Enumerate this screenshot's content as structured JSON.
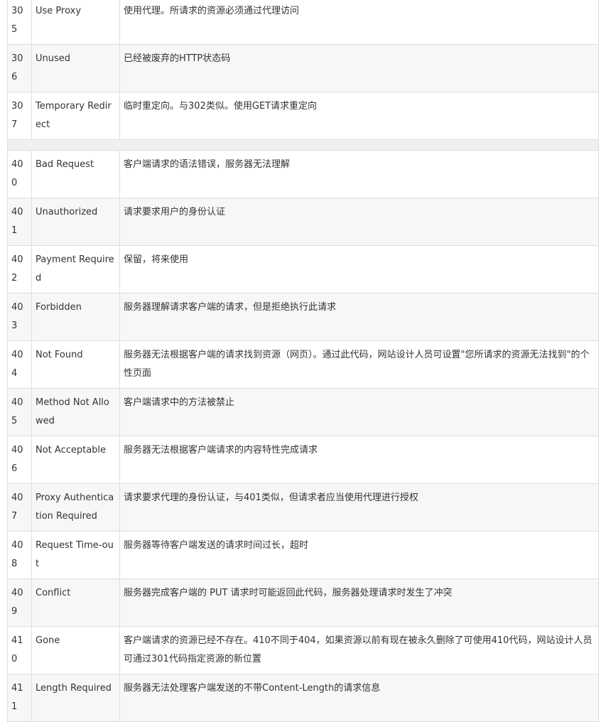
{
  "status_rows_3xx": [
    {
      "code": "305",
      "message": "Use Proxy",
      "description": "使用代理。所请求的资源必须通过代理访问"
    },
    {
      "code": "306",
      "message": "Unused",
      "description": "已经被废弃的HTTP状态码"
    },
    {
      "code": "307",
      "message": "Temporary Redirect",
      "description": "临时重定向。与302类似。使用GET请求重定向"
    }
  ],
  "status_rows_4xx": [
    {
      "code": "400",
      "message": "Bad Request",
      "description": "客户端请求的语法错误，服务器无法理解"
    },
    {
      "code": "401",
      "message": "Unauthorized",
      "description": "请求要求用户的身份认证"
    },
    {
      "code": "402",
      "message": "Payment Required",
      "description": "保留，将来使用"
    },
    {
      "code": "403",
      "message": "Forbidden",
      "description": "服务器理解请求客户端的请求，但是拒绝执行此请求"
    },
    {
      "code": "404",
      "message": "Not Found",
      "description": "服务器无法根据客户端的请求找到资源（网页）。通过此代码，网站设计人员可设置\"您所请求的资源无法找到\"的个性页面"
    },
    {
      "code": "405",
      "message": "Method Not Allowed",
      "description": "客户端请求中的方法被禁止"
    },
    {
      "code": "406",
      "message": "Not Acceptable",
      "description": "服务器无法根据客户端请求的内容特性完成请求"
    },
    {
      "code": "407",
      "message": "Proxy Authentication Required",
      "description": "请求要求代理的身份认证，与401类似，但请求者应当使用代理进行授权"
    },
    {
      "code": "408",
      "message": "Request Time-out",
      "description": "服务器等待客户端发送的请求时间过长，超时"
    },
    {
      "code": "409",
      "message": "Conflict",
      "description": "服务器完成客户端的 PUT 请求时可能返回此代码，服务器处理请求时发生了冲突"
    },
    {
      "code": "410",
      "message": "Gone",
      "description": "客户端请求的资源已经不存在。410不同于404，如果资源以前有现在被永久删除了可使用410代码，网站设计人员可通过301代码指定资源的新位置"
    },
    {
      "code": "411",
      "message": "Length Required",
      "description": "服务器无法处理客户端发送的不带Content-Length的请求信息"
    }
  ]
}
